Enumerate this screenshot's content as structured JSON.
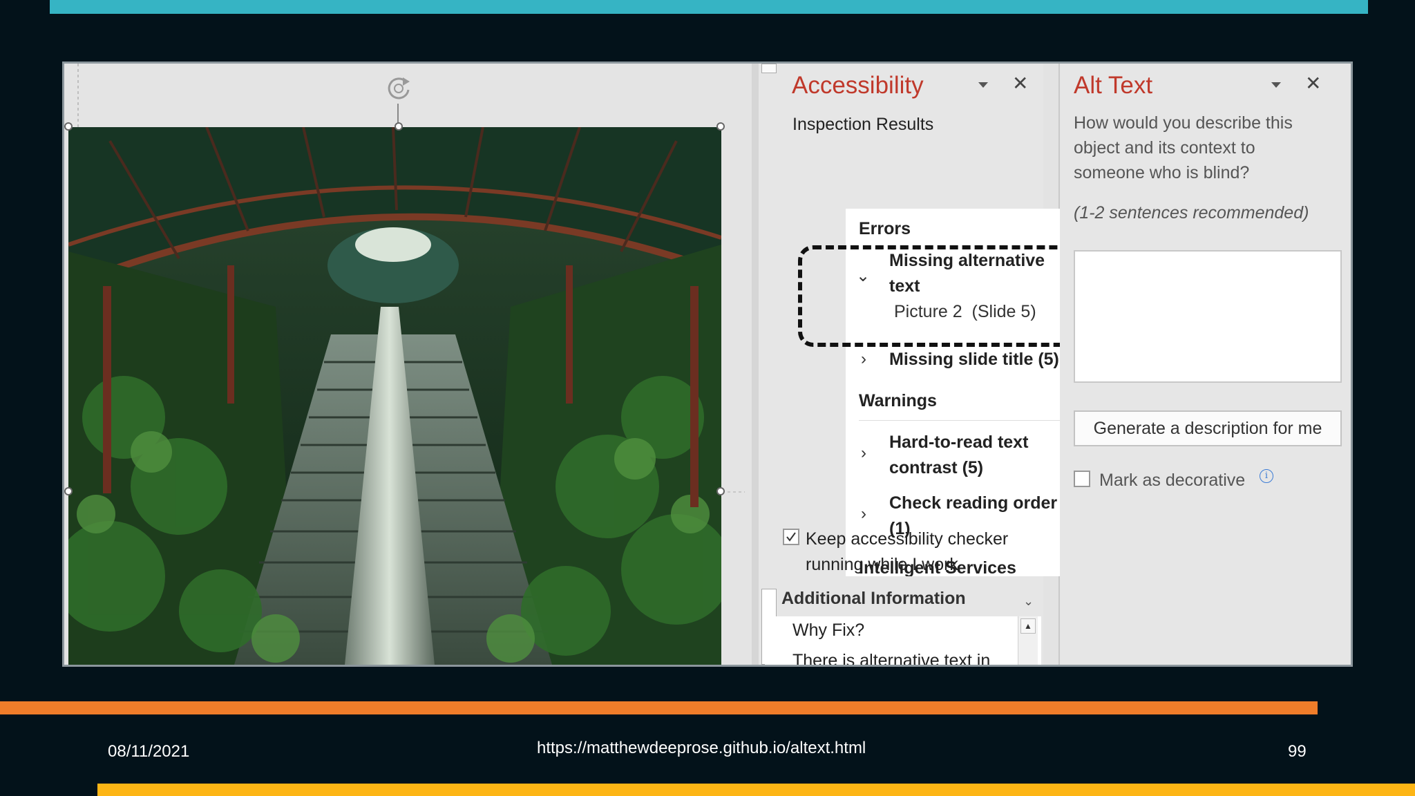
{
  "footer": {
    "date": "08/11/2021",
    "url": "https://matthewdeeprose.github.io/altext.html",
    "page": "99"
  },
  "accessibility": {
    "title": "Accessibility",
    "subtitle": "Inspection Results",
    "errors_heading": "Errors",
    "error_1_line1": "Missing alternative",
    "error_1_line2": "text",
    "error_1_detail": "Picture 2  (Slide 5)",
    "error_2": "Missing slide title (5)",
    "warnings_heading": "Warnings",
    "warning_1_line1": "Hard-to-read text",
    "warning_1_line2": "contrast (5)",
    "warning_2_line1": "Check reading order",
    "warning_2_line2": "(1)",
    "intelligent_heading": "Intelligent Services",
    "keep_running_line1": "Keep accessibility checker",
    "keep_running_line2": "running while I work",
    "keep_running_checked": true,
    "additional_info": "Additional Information",
    "why_fix": "Why Fix?",
    "why_fix_cut": "There is alternative text in"
  },
  "alt_text": {
    "title": "Alt Text",
    "question_line1": "How would you describe this",
    "question_line2": "object and its context to",
    "question_line3": "someone who is blind?",
    "hint": "(1-2 sentences recommended)",
    "textbox_value": "",
    "generate_button": "Generate a description for me",
    "decorative_label": "Mark as decorative",
    "decorative_checked": false
  },
  "colors": {
    "top_bar": "#36b4c4",
    "orange_bar": "#f07d2a",
    "yellow_bar": "#fdb515",
    "background": "#03121a",
    "pane_title": "#c0392b"
  }
}
